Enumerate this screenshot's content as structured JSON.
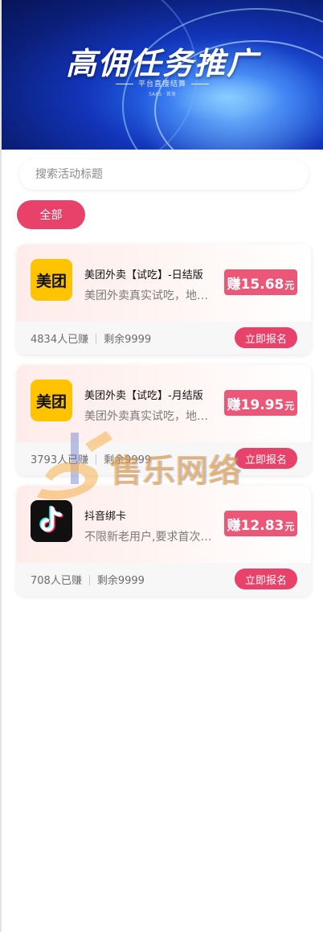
{
  "banner": {
    "title": "高佣任务推广",
    "subtitle": "平台直接结算",
    "tiny": "SAAS · 首发"
  },
  "search": {
    "placeholder": "搜索活动标题",
    "value": ""
  },
  "filter": {
    "active_label": "全部"
  },
  "tasks": [
    {
      "logo": "美团",
      "logo_icon": "meituan-logo-icon",
      "title": "美团外卖【试吃】-日结版",
      "desc": "美团外卖真实试吃，地区不限",
      "reward_prefix": "赚",
      "reward": "15.68",
      "reward_unit": "元",
      "earned": "4834人已赚",
      "remaining": "剩余9999",
      "button": "立即报名"
    },
    {
      "logo": "美团",
      "logo_icon": "meituan-logo-icon",
      "title": "美团外卖【试吃】-月结版",
      "desc": "美团外卖真实试吃，地区不限",
      "reward_prefix": "赚",
      "reward": "19.95",
      "reward_unit": "元",
      "earned": "3793人已赚",
      "remaining": "剩余9999",
      "button": "立即报名"
    },
    {
      "logo": "",
      "logo_icon": "douyin-logo-icon",
      "title": "抖音绑卡",
      "desc": "不限新老用户,要求首次绑卡",
      "reward_prefix": "赚",
      "reward": "12.83",
      "reward_unit": "元",
      "earned": "708人已赚",
      "remaining": "剩余9999",
      "button": "立即报名"
    }
  ],
  "watermark": {
    "text": "售乐网络"
  },
  "colors": {
    "accent": "#e8416a",
    "reward_bg": "#ec5777",
    "meituan": "#ffc300"
  }
}
